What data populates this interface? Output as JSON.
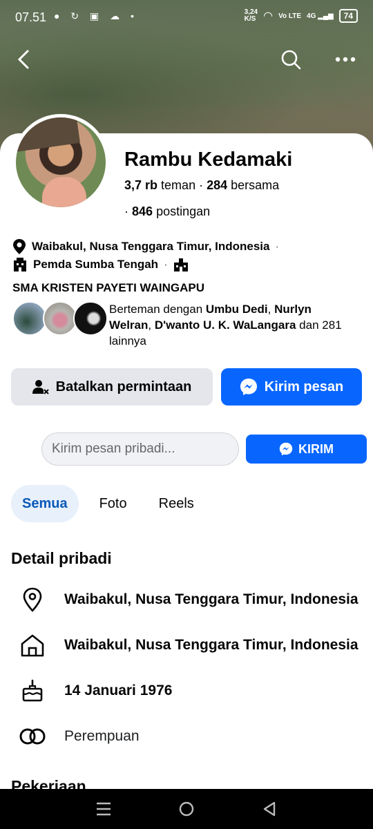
{
  "status": {
    "time": "07.51",
    "speed": "3,24\nK/S",
    "network": "Vo LTE",
    "signal": "4G",
    "battery": "74"
  },
  "profile": {
    "name": "Rambu Kedamaki",
    "friends_count": "3,7 rb",
    "friends_label": "teman",
    "mutual_count": "284",
    "mutual_label": "bersama",
    "posts_count": "846",
    "posts_label": "postingan",
    "location": "Waibakul, Nusa Tenggara Timur, Indonesia",
    "work": "Pemda Sumba Tengah",
    "school": "SMA KRISTEN PAYETI WAINGAPU"
  },
  "mutual": {
    "prefix": "Berteman dengan",
    "friend1": "Umbu Dedi",
    "friend2": "Nurlyn Welran",
    "friend3": "D'wanto U. K. WaLangara",
    "suffix_word": "dan",
    "others": "281 lainnya"
  },
  "actions": {
    "cancel_request": "Batalkan permintaan",
    "send_message": "Kirim pesan"
  },
  "message": {
    "placeholder": "Kirim pesan pribadi...",
    "send": "KIRIM"
  },
  "tabs": [
    "Semua",
    "Foto",
    "Reels"
  ],
  "details": {
    "title": "Detail pribadi",
    "items": [
      {
        "icon": "location-pin-icon",
        "text": "Waibakul, Nusa Tenggara Timur, Indonesia"
      },
      {
        "icon": "home-icon",
        "text": "Waibakul, Nusa Tenggara Timur, Indonesia"
      },
      {
        "icon": "birthday-cake-icon",
        "text": "14 Januari 1976"
      },
      {
        "icon": "gender-icon",
        "text": "Perempuan"
      }
    ]
  },
  "work_section": {
    "title": "Pekerjaan"
  },
  "colors": {
    "accent": "#0866ff",
    "tab_active_bg": "#e7f0fb",
    "button_gray": "#e4e6eb"
  }
}
